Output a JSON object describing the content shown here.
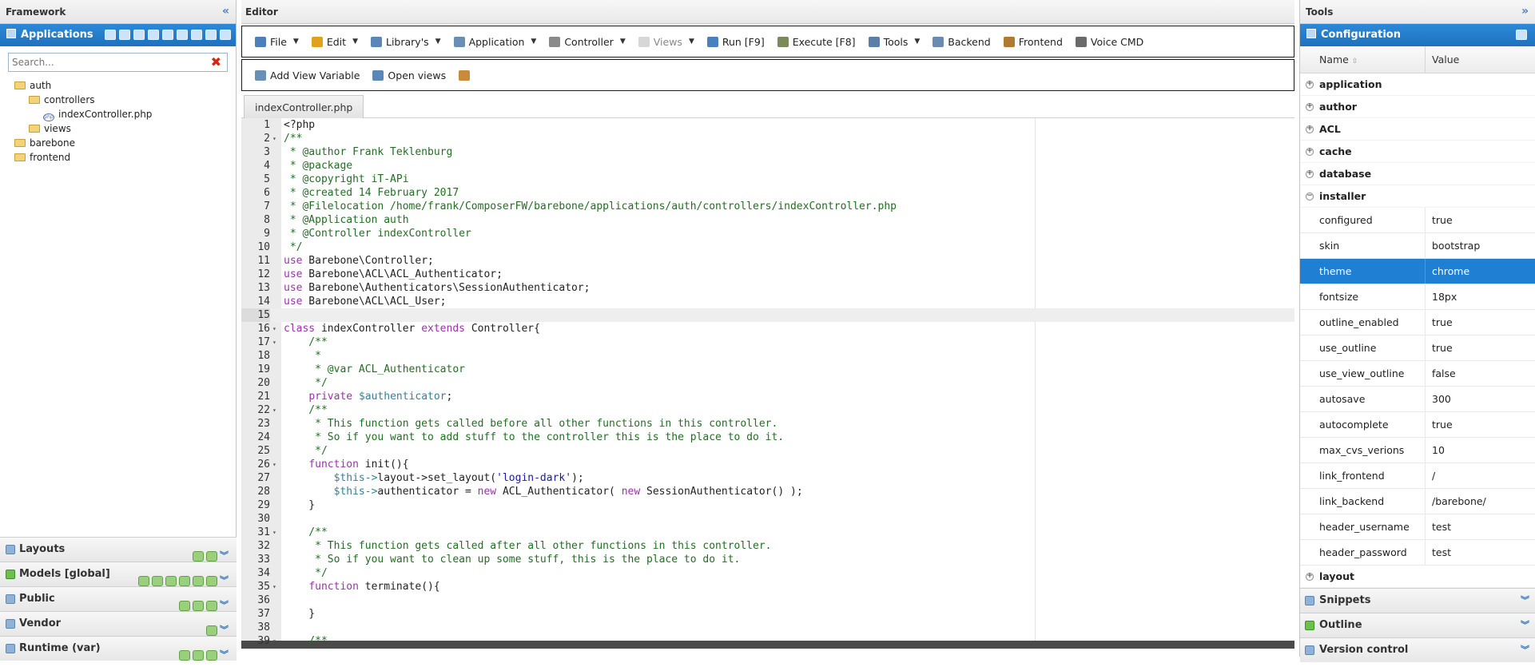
{
  "left": {
    "title": "Framework",
    "applications_label": "Applications",
    "search_placeholder": "Search...",
    "tree": [
      {
        "label": "auth",
        "level": 0,
        "type": "folder"
      },
      {
        "label": "controllers",
        "level": 1,
        "type": "folder"
      },
      {
        "label": "indexController.php",
        "level": 2,
        "type": "php"
      },
      {
        "label": "views",
        "level": 1,
        "type": "folder"
      },
      {
        "label": "barebone",
        "level": 0,
        "type": "folder"
      },
      {
        "label": "frontend",
        "level": 0,
        "type": "folder"
      }
    ],
    "accordions": [
      "Layouts",
      "Models [global]",
      "Public",
      "Vendor",
      "Runtime (var)"
    ]
  },
  "editor": {
    "title": "Editor",
    "menu": [
      {
        "label": "File",
        "icon": "file-icon",
        "caret": true
      },
      {
        "label": "Edit",
        "icon": "pencil-icon",
        "caret": true
      },
      {
        "label": "Library's",
        "icon": "library-icon",
        "caret": true
      },
      {
        "label": "Application",
        "icon": "window-icon",
        "caret": true
      },
      {
        "label": "Controller",
        "icon": "controller-icon",
        "caret": true
      },
      {
        "label": "Views",
        "icon": "views-icon",
        "caret": true,
        "disabled": true
      },
      {
        "label": "Run [F9]",
        "icon": "run-icon",
        "caret": false
      },
      {
        "label": "Execute [F8]",
        "icon": "gear-icon",
        "caret": false
      },
      {
        "label": "Tools",
        "icon": "wrench-icon",
        "caret": true
      },
      {
        "label": "Backend",
        "icon": "backend-icon",
        "caret": false
      },
      {
        "label": "Frontend",
        "icon": "frontend-icon",
        "caret": false
      },
      {
        "label": "Voice CMD",
        "icon": "speaker-icon",
        "caret": false
      }
    ],
    "toolbar2": [
      {
        "label": "Add View Variable",
        "icon": "add-variable-icon"
      },
      {
        "label": "Open views",
        "icon": "open-views-icon"
      },
      {
        "label": "",
        "icon": "wrench-icon"
      }
    ],
    "tab": "indexController.php",
    "active_line": 15,
    "fold_lines": [
      2,
      16,
      17,
      22,
      26,
      31,
      35,
      39
    ],
    "code": [
      [
        [
          "t",
          "<?php"
        ]
      ],
      [
        [
          "c",
          "/**"
        ]
      ],
      [
        [
          "c",
          " * @author Frank Teklenburg"
        ]
      ],
      [
        [
          "c",
          " * @package"
        ]
      ],
      [
        [
          "c",
          " * @copyright iT-APi"
        ]
      ],
      [
        [
          "c",
          " * @created 14 February 2017"
        ]
      ],
      [
        [
          "c",
          " * @Filelocation /home/frank/ComposerFW/barebone/applications/auth/controllers/indexController.php"
        ]
      ],
      [
        [
          "c",
          " * @Application auth"
        ]
      ],
      [
        [
          "c",
          " * @Controller indexController"
        ]
      ],
      [
        [
          "c",
          " */"
        ]
      ],
      [
        [
          "k",
          "use"
        ],
        [
          "t",
          " Barebone\\Controller;"
        ]
      ],
      [
        [
          "k",
          "use"
        ],
        [
          "t",
          " Barebone\\ACL\\ACL_Authenticator;"
        ]
      ],
      [
        [
          "k",
          "use"
        ],
        [
          "t",
          " Barebone\\Authenticators\\SessionAuthenticator;"
        ]
      ],
      [
        [
          "k",
          "use"
        ],
        [
          "t",
          " Barebone\\ACL\\ACL_User;"
        ]
      ],
      [
        [
          "t",
          ""
        ]
      ],
      [
        [
          "k",
          "class"
        ],
        [
          "t",
          " indexController "
        ],
        [
          "k",
          "extends"
        ],
        [
          "t",
          " Controller{"
        ]
      ],
      [
        [
          "c",
          "    /**"
        ]
      ],
      [
        [
          "c",
          "     *"
        ]
      ],
      [
        [
          "c",
          "     * @var ACL_Authenticator"
        ]
      ],
      [
        [
          "c",
          "     */"
        ]
      ],
      [
        [
          "t",
          "    "
        ],
        [
          "k",
          "private"
        ],
        [
          "t",
          " "
        ],
        [
          "v",
          "$authenticator"
        ],
        [
          "t",
          ";"
        ]
      ],
      [
        [
          "c",
          "    /**"
        ]
      ],
      [
        [
          "c",
          "     * This function gets called before all other functions in this controller."
        ]
      ],
      [
        [
          "c",
          "     * So if you want to add stuff to the controller this is the place to do it."
        ]
      ],
      [
        [
          "c",
          "     */"
        ]
      ],
      [
        [
          "t",
          "    "
        ],
        [
          "k",
          "function"
        ],
        [
          "t",
          " init(){"
        ]
      ],
      [
        [
          "t",
          "        "
        ],
        [
          "v",
          "$this->"
        ],
        [
          "t",
          "layout->set_layout("
        ],
        [
          "s",
          "'login-dark'"
        ],
        [
          "t",
          ");"
        ]
      ],
      [
        [
          "t",
          "        "
        ],
        [
          "v",
          "$this->"
        ],
        [
          "t",
          "authenticator = "
        ],
        [
          "k",
          "new"
        ],
        [
          "t",
          " ACL_Authenticator( "
        ],
        [
          "k",
          "new"
        ],
        [
          "t",
          " SessionAuthenticator() );"
        ]
      ],
      [
        [
          "t",
          "    }"
        ]
      ],
      [
        [
          "t",
          ""
        ]
      ],
      [
        [
          "c",
          "    /**"
        ]
      ],
      [
        [
          "c",
          "     * This function gets called after all other functions in this controller."
        ]
      ],
      [
        [
          "c",
          "     * So if you want to clean up some stuff, this is the place to do it."
        ]
      ],
      [
        [
          "c",
          "     */"
        ]
      ],
      [
        [
          "t",
          "    "
        ],
        [
          "k",
          "function"
        ],
        [
          "t",
          " terminate(){"
        ]
      ],
      [
        [
          "t",
          ""
        ]
      ],
      [
        [
          "t",
          "    }"
        ]
      ],
      [
        [
          "t",
          ""
        ]
      ],
      [
        [
          "c",
          "    /**"
        ]
      ]
    ]
  },
  "right": {
    "title": "Tools",
    "configuration_label": "Configuration",
    "col_name": "Name",
    "col_value": "Value",
    "groups_before": [
      "application",
      "author",
      "ACL",
      "cache",
      "database"
    ],
    "open_group": "installer",
    "rows": [
      {
        "name": "configured",
        "value": "true"
      },
      {
        "name": "skin",
        "value": "bootstrap"
      },
      {
        "name": "theme",
        "value": "chrome",
        "selected": true
      },
      {
        "name": "fontsize",
        "value": "18px"
      },
      {
        "name": "outline_enabled",
        "value": "true"
      },
      {
        "name": "use_outline",
        "value": "true"
      },
      {
        "name": "use_view_outline",
        "value": "false"
      },
      {
        "name": "autosave",
        "value": "300"
      },
      {
        "name": "autocomplete",
        "value": "true"
      },
      {
        "name": "max_cvs_verions",
        "value": "10"
      },
      {
        "name": "link_frontend",
        "value": "/"
      },
      {
        "name": "link_backend",
        "value": "/barebone/"
      },
      {
        "name": "header_username",
        "value": "test"
      },
      {
        "name": "header_password",
        "value": "test"
      }
    ],
    "group_after": "layout",
    "accordions": [
      "Snippets",
      "Outline",
      "Version control"
    ]
  },
  "colors": {
    "accent": "#1e7fd3",
    "comment": "#236e24",
    "keyword": "#9933aa",
    "variable": "#318495",
    "string": "#1a1aa6"
  }
}
